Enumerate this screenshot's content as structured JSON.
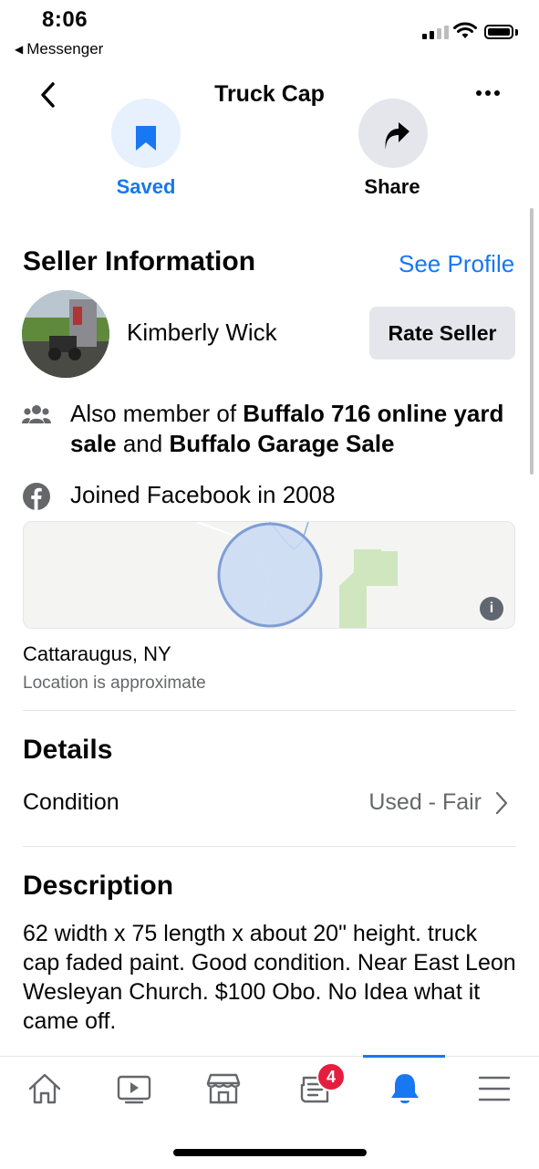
{
  "status_bar": {
    "time": "8:06",
    "back_app": "Messenger"
  },
  "header": {
    "title": "Truck Cap"
  },
  "actions": {
    "saved_label": "Saved",
    "share_label": "Share"
  },
  "seller": {
    "section_title": "Seller Information",
    "see_profile": "See Profile",
    "name": "Kimberly Wick",
    "rate_button": "Rate Seller",
    "member_prefix": "Also member of ",
    "group_1": "Buffalo 716 online yard sale",
    "member_join": " and ",
    "group_2": "Buffalo Garage Sale",
    "joined": "Joined Facebook in 2008"
  },
  "location": {
    "city": "Cattaraugus, NY",
    "note": "Location is approximate"
  },
  "details": {
    "section_title": "Details",
    "condition_label": "Condition",
    "condition_value": "Used - Fair"
  },
  "description": {
    "section_title": "Description",
    "text": "62 width x 75 length x about 20\" height. truck cap faded paint. Good condition. Near East Leon Wesleyan Church. $100 Obo. No Idea what it came off."
  },
  "tabbar": {
    "tabs": [
      "home-icon",
      "watch-icon",
      "marketplace-icon",
      "news-icon",
      "notifications-icon",
      "menu-icon"
    ],
    "active_tab": "notifications-icon",
    "news_badge": "4"
  },
  "colors": {
    "accent": "#1877f2",
    "badge": "#e41e3f",
    "secondary_text": "#65676b"
  }
}
